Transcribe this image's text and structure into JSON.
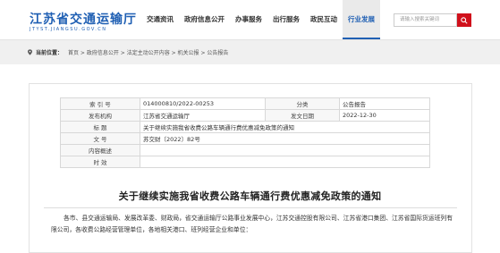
{
  "logo": {
    "name": "江苏省交通运输厅",
    "domain": "JTYST.JIANGSU.GOV.CN"
  },
  "nav": [
    {
      "label": "交通资讯"
    },
    {
      "label": "政府信息公开"
    },
    {
      "label": "办事服务"
    },
    {
      "label": "出行服务"
    },
    {
      "label": "政民互动"
    },
    {
      "label": "行业发展"
    }
  ],
  "search": {
    "placeholder": "请输入搜索关键词"
  },
  "breadcrumb": {
    "location_label": "当前位置：",
    "path": "首页 > 政府信息公开 > 法定主动公开内容 > 机关公报 > 公告报告"
  },
  "meta": {
    "index_label": "索 引 号",
    "index_value": "014000810/2022-00253",
    "category_label": "分类",
    "category_value": "公告报告",
    "publisher_label": "发布机构",
    "publisher_value": "江苏省交通运输厅",
    "date_label": "发文日期",
    "date_value": "2022-12-30",
    "title_label": "标 题",
    "title_value": "关于继续实施我省收费公路车辆通行费优惠减免政策的通知",
    "docno_label": "文 号",
    "docno_value": "苏交财〔2022〕82号",
    "summary_label": "内容概述",
    "summary_value": "",
    "validity_label": "时 效",
    "validity_value": ""
  },
  "article": {
    "title": "关于继续实施我省收费公路车辆通行费优惠减免政策的通知",
    "body": "各市、县交通运输局、发展改革委、财政局，省交通运输厅公路事业发展中心，江苏交通控股有限公司、江苏省港口集团、江苏省国际货运班列有限公司，各收费公路经营管理单位，各地相关港口、班列经营企业和单位："
  }
}
